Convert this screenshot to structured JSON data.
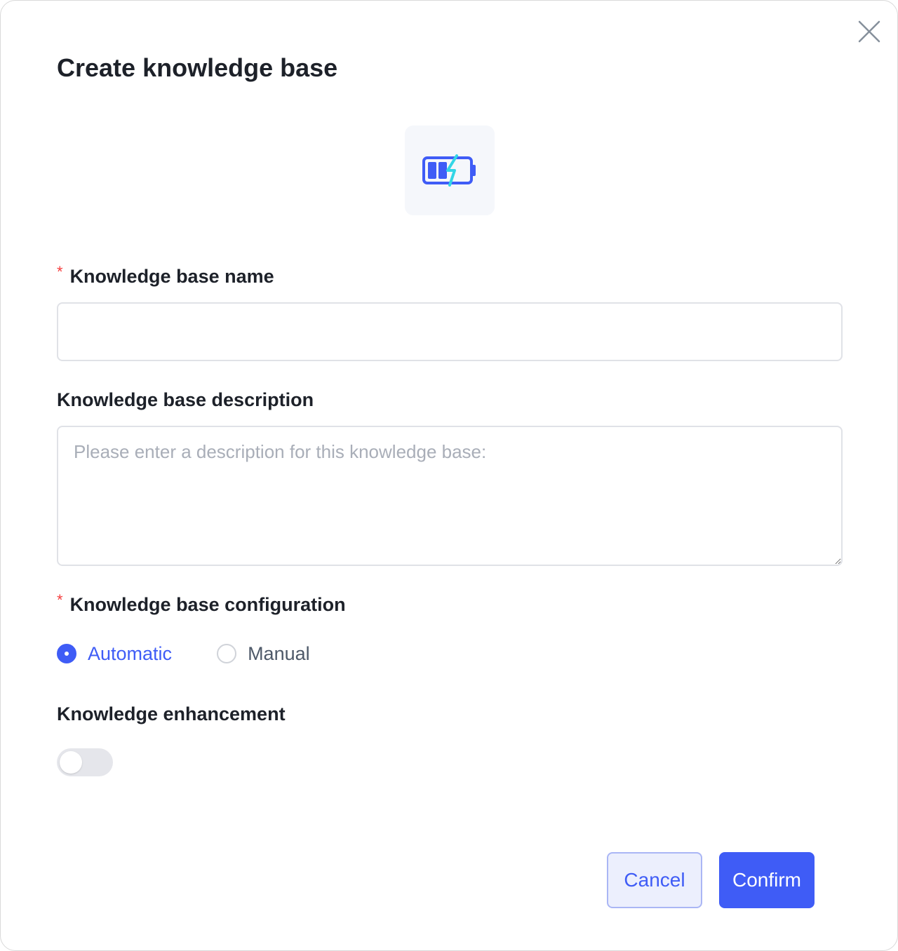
{
  "dialog": {
    "title": "Create knowledge base",
    "close_icon": "close-icon",
    "avatar_icon": "battery-charging-icon"
  },
  "form": {
    "name": {
      "required_mark": "*",
      "label": "Knowledge base name",
      "value": "",
      "placeholder": ""
    },
    "description": {
      "label": "Knowledge base description",
      "value": "",
      "placeholder": "Please enter a description for this knowledge base:"
    },
    "configuration": {
      "required_mark": "*",
      "label": "Knowledge base configuration",
      "options": [
        {
          "label": "Automatic",
          "selected": true
        },
        {
          "label": "Manual",
          "selected": false
        }
      ]
    },
    "enhancement": {
      "label": "Knowledge enhancement",
      "enabled": false
    }
  },
  "footer": {
    "cancel_label": "Cancel",
    "confirm_label": "Confirm"
  },
  "colors": {
    "accent": "#3f5cf6",
    "required": "#f53f3f",
    "avatar_bg": "#f5f7fb",
    "icon_cyan": "#33d6e6"
  }
}
